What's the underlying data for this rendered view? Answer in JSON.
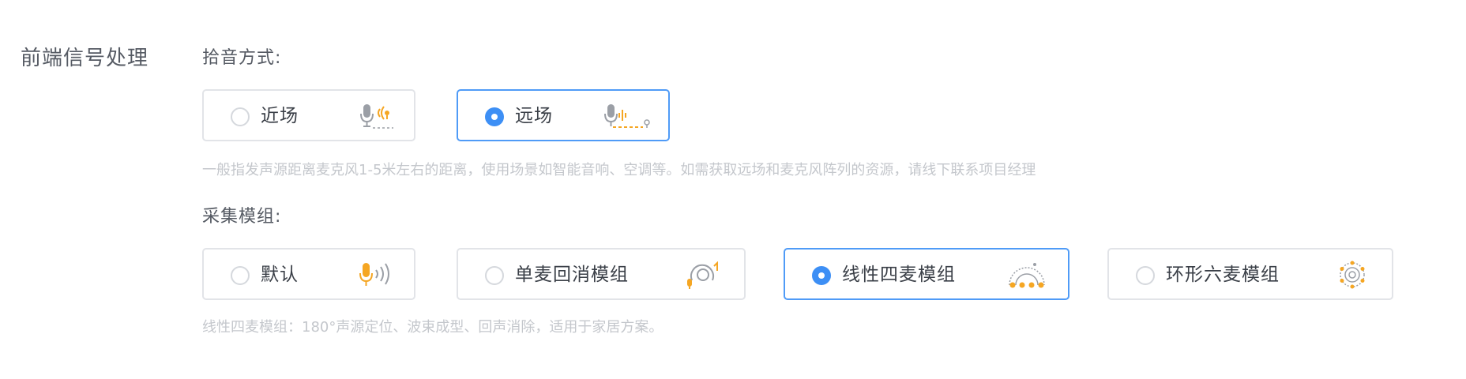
{
  "section": {
    "title": "前端信号处理"
  },
  "pickup": {
    "label": "拾音方式:",
    "options": [
      {
        "label": "近场",
        "icon": "near-field-mic-icon",
        "selected": false
      },
      {
        "label": "远场",
        "icon": "far-field-mic-icon",
        "selected": true
      }
    ],
    "hint": "一般指发声源距离麦克风1-5米左右的距离，使用场景如智能音响、空调等。如需获取远场和麦克风阵列的资源，请线下联系项目经理"
  },
  "module": {
    "label": "采集模组:",
    "options": [
      {
        "label": "默认",
        "icon": "mic-sound-icon",
        "selected": false
      },
      {
        "label": "单麦回消模组",
        "icon": "echo-cancel-icon",
        "selected": false
      },
      {
        "label": "线性四麦模组",
        "icon": "linear-array-icon",
        "selected": true
      },
      {
        "label": "环形六麦模组",
        "icon": "ring-array-icon",
        "selected": false
      }
    ],
    "hint": "线性四麦模组：180°声源定位、波束成型、回声消除，适用于家居方案。"
  },
  "colors": {
    "accent": "#3d8ff5",
    "border": "#e2e4e8",
    "icon_orange": "#f5a623",
    "icon_gray": "#9b9fa6"
  }
}
